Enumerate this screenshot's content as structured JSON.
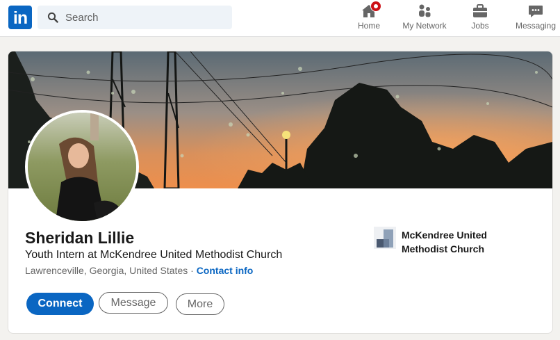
{
  "nav": {
    "logo_text": "in",
    "search_placeholder": "Search",
    "items": [
      {
        "label": "Home",
        "icon": "home-icon",
        "has_badge": true
      },
      {
        "label": "My Network",
        "icon": "network-icon"
      },
      {
        "label": "Jobs",
        "icon": "briefcase-icon"
      },
      {
        "label": "Messaging",
        "icon": "chat-bubble-icon"
      }
    ]
  },
  "profile": {
    "name": "Sheridan Lillie",
    "headline": "Youth Intern at McKendree United Methodist Church",
    "location": "Lawrenceville, Georgia, United States",
    "separator": " · ",
    "contact_link": "Contact info",
    "buttons": {
      "connect": "Connect",
      "message": "Message",
      "more": "More"
    },
    "company": {
      "name": "McKendree United Methodist Church",
      "logo_icon": "company-logo-icon"
    }
  },
  "colors": {
    "brand": "#0a66c2",
    "badge": "#cc1016",
    "background": "#f3f2ef"
  }
}
